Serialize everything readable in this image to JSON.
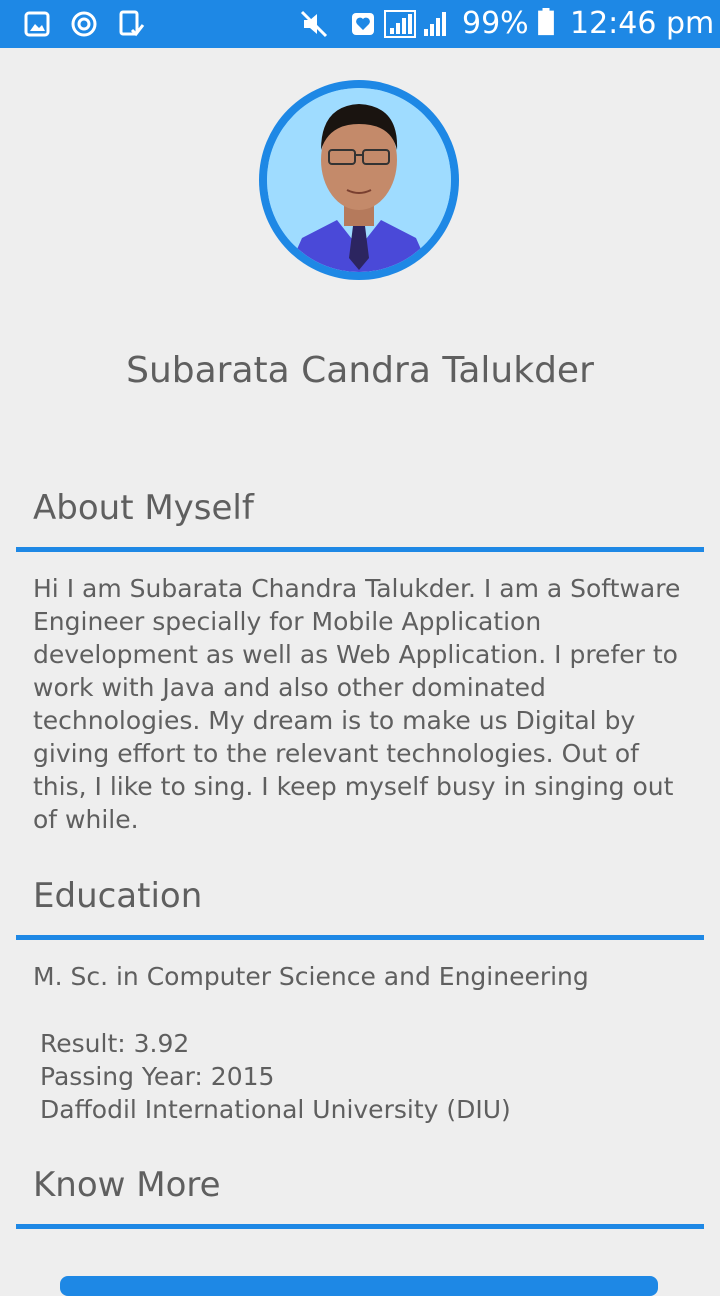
{
  "status_bar": {
    "battery_percent": "99%",
    "time": "12:46 pm",
    "icons": [
      "gallery-icon",
      "sync-icon",
      "task-check-icon",
      "mute-icon",
      "heart-status-icon",
      "signal-icon",
      "signal-icon",
      "battery-icon"
    ]
  },
  "profile": {
    "name": "Subarata Candra Talukder"
  },
  "about": {
    "title": "About Myself",
    "text": "Hi I am Subarata Chandra Talukder. I am a Software Engineer specially for Mobile Application development as well as Web Application. I prefer to work with Java and also other dominated technologies. My dream is to make us Digital by giving effort to the relevant technologies. Out of this, I like to sing. I keep myself busy in singing out of while."
  },
  "education": {
    "title": "Education",
    "degree": "M. Sc. in Computer Science and Engineering",
    "result": "Result: 3.92",
    "passing_year": "Passing Year: 2015",
    "university": "Daffodil International University (DIU)"
  },
  "know_more": {
    "title": "Know More"
  },
  "colors": {
    "accent": "#1e88e5",
    "background": "#eeeeee",
    "text": "#5f5f5f"
  }
}
